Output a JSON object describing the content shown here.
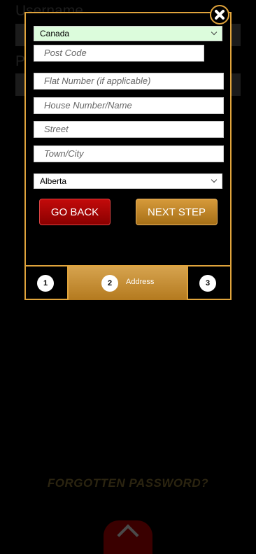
{
  "background": {
    "username_label": "Username",
    "password_label": "P",
    "forgotten_password": "FORGOTTEN PASSWORD?"
  },
  "form": {
    "country_value": "Canada",
    "post_code_placeholder": "Post Code",
    "flat_placeholder": "Flat Number (if applicable)",
    "house_placeholder": "House Number/Name",
    "street_placeholder": "Street",
    "town_placeholder": "Town/City",
    "region_value": "Alberta"
  },
  "buttons": {
    "go_back": "GO BACK",
    "next_step": "NEXT STEP"
  },
  "steps": {
    "step1": "1",
    "step2": "2",
    "step2_label": "Address",
    "step3": "3"
  },
  "colors": {
    "accent_gold": "#e0a43c",
    "back_red": "#c30a0a",
    "country_bg": "#dcfcdc"
  }
}
